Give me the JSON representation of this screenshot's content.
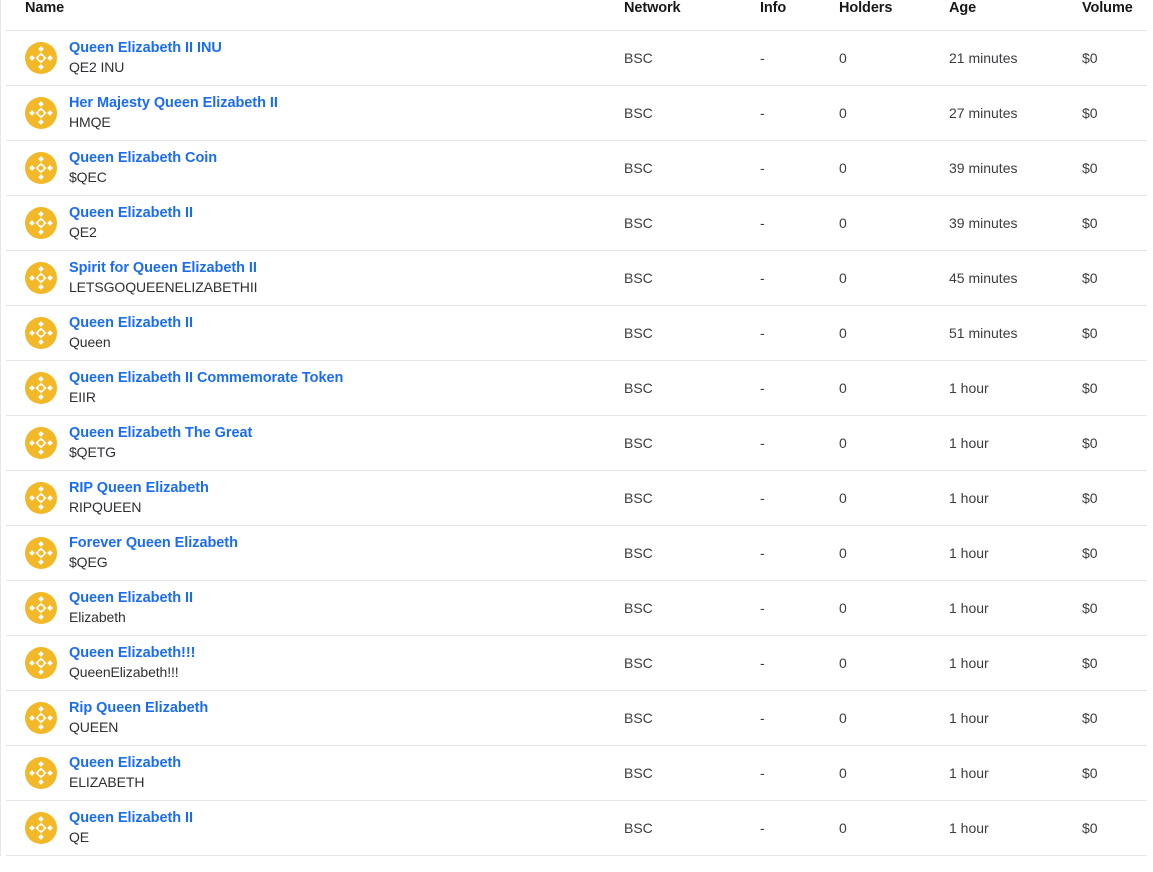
{
  "table": {
    "columns": [
      {
        "key": "name",
        "label": "Name"
      },
      {
        "key": "network",
        "label": "Network"
      },
      {
        "key": "info",
        "label": "Info"
      },
      {
        "key": "holders",
        "label": "Holders"
      },
      {
        "key": "age",
        "label": "Age"
      },
      {
        "key": "volume",
        "label": "Volume"
      }
    ],
    "icon_name": "binance-bnb-coin-icon",
    "icon_color": "#f2b828",
    "link_color": "#1a6cf0",
    "rows": [
      {
        "name": "Queen Elizabeth II INU",
        "symbol": "QE2 INU",
        "network": "BSC",
        "info": "-",
        "holders": "0",
        "age": "21 minutes",
        "volume": "$0"
      },
      {
        "name": "Her Majesty Queen Elizabeth II",
        "symbol": "HMQE",
        "network": "BSC",
        "info": "-",
        "holders": "0",
        "age": "27 minutes",
        "volume": "$0"
      },
      {
        "name": "Queen Elizabeth Coin",
        "symbol": "$QEC",
        "network": "BSC",
        "info": "-",
        "holders": "0",
        "age": "39 minutes",
        "volume": "$0"
      },
      {
        "name": "Queen Elizabeth II",
        "symbol": "QE2",
        "network": "BSC",
        "info": "-",
        "holders": "0",
        "age": "39 minutes",
        "volume": "$0"
      },
      {
        "name": "Spirit for Queen Elizabeth II",
        "symbol": "LETSGOQUEENELIZABETHII",
        "network": "BSC",
        "info": "-",
        "holders": "0",
        "age": "45 minutes",
        "volume": "$0"
      },
      {
        "name": "Queen Elizabeth II",
        "symbol": "Queen",
        "network": "BSC",
        "info": "-",
        "holders": "0",
        "age": "51 minutes",
        "volume": "$0"
      },
      {
        "name": "Queen Elizabeth II Commemorate Token",
        "symbol": "EIIR",
        "network": "BSC",
        "info": "-",
        "holders": "0",
        "age": "1 hour",
        "volume": "$0"
      },
      {
        "name": "Queen Elizabeth The Great",
        "symbol": "$QETG",
        "network": "BSC",
        "info": "-",
        "holders": "0",
        "age": "1 hour",
        "volume": "$0"
      },
      {
        "name": "RIP Queen Elizabeth",
        "symbol": "RIPQUEEN",
        "network": "BSC",
        "info": "-",
        "holders": "0",
        "age": "1 hour",
        "volume": "$0"
      },
      {
        "name": "Forever Queen Elizabeth",
        "symbol": "$QEG",
        "network": "BSC",
        "info": "-",
        "holders": "0",
        "age": "1 hour",
        "volume": "$0"
      },
      {
        "name": "Queen Elizabeth II",
        "symbol": "Elizabeth",
        "network": "BSC",
        "info": "-",
        "holders": "0",
        "age": "1 hour",
        "volume": "$0"
      },
      {
        "name": "Queen Elizabeth!!!",
        "symbol": "QueenElizabeth!!!",
        "network": "BSC",
        "info": "-",
        "holders": "0",
        "age": "1 hour",
        "volume": "$0"
      },
      {
        "name": "Rip Queen Elizabeth",
        "symbol": "QUEEN",
        "network": "BSC",
        "info": "-",
        "holders": "0",
        "age": "1 hour",
        "volume": "$0"
      },
      {
        "name": "Queen Elizabeth",
        "symbol": "ELIZABETH",
        "network": "BSC",
        "info": "-",
        "holders": "0",
        "age": "1 hour",
        "volume": "$0"
      },
      {
        "name": "Queen Elizabeth II",
        "symbol": "QE",
        "network": "BSC",
        "info": "-",
        "holders": "0",
        "age": "1 hour",
        "volume": "$0"
      }
    ]
  }
}
